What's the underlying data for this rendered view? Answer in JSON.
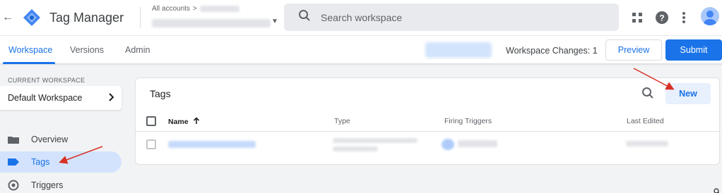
{
  "header": {
    "back_icon": "arrow-back-icon",
    "app_title": "Tag Manager",
    "breadcrumb_all_accounts": "All accounts",
    "breadcrumb_separator": ">",
    "search_placeholder": "Search workspace",
    "icons": [
      "apps-grid-icon",
      "help-icon",
      "more-vert-icon",
      "account-avatar-icon"
    ]
  },
  "tabs": [
    {
      "label": "Workspace",
      "active": true
    },
    {
      "label": "Versions",
      "active": false
    },
    {
      "label": "Admin",
      "active": false
    }
  ],
  "toolbar": {
    "workspace_changes_label": "Workspace Changes:",
    "workspace_changes_count": "1",
    "preview_label": "Preview",
    "submit_label": "Submit"
  },
  "sidebar": {
    "current_workspace_label": "CURRENT WORKSPACE",
    "workspace_name": "Default Workspace",
    "items": [
      {
        "label": "Overview",
        "icon": "overview-icon",
        "active": false
      },
      {
        "label": "Tags",
        "icon": "tag-icon",
        "active": true
      },
      {
        "label": "Triggers",
        "icon": "trigger-icon",
        "active": false
      }
    ]
  },
  "tags_card": {
    "title": "Tags",
    "new_button": "New",
    "columns": [
      "Name",
      "Type",
      "Firing Triggers",
      "Last Edited"
    ],
    "sort_icon": "arrow-upward-icon"
  },
  "colors": {
    "accent": "#1a73e8",
    "active_nav_bg": "#d3e3fd",
    "annotation_arrow": "#d93025"
  }
}
